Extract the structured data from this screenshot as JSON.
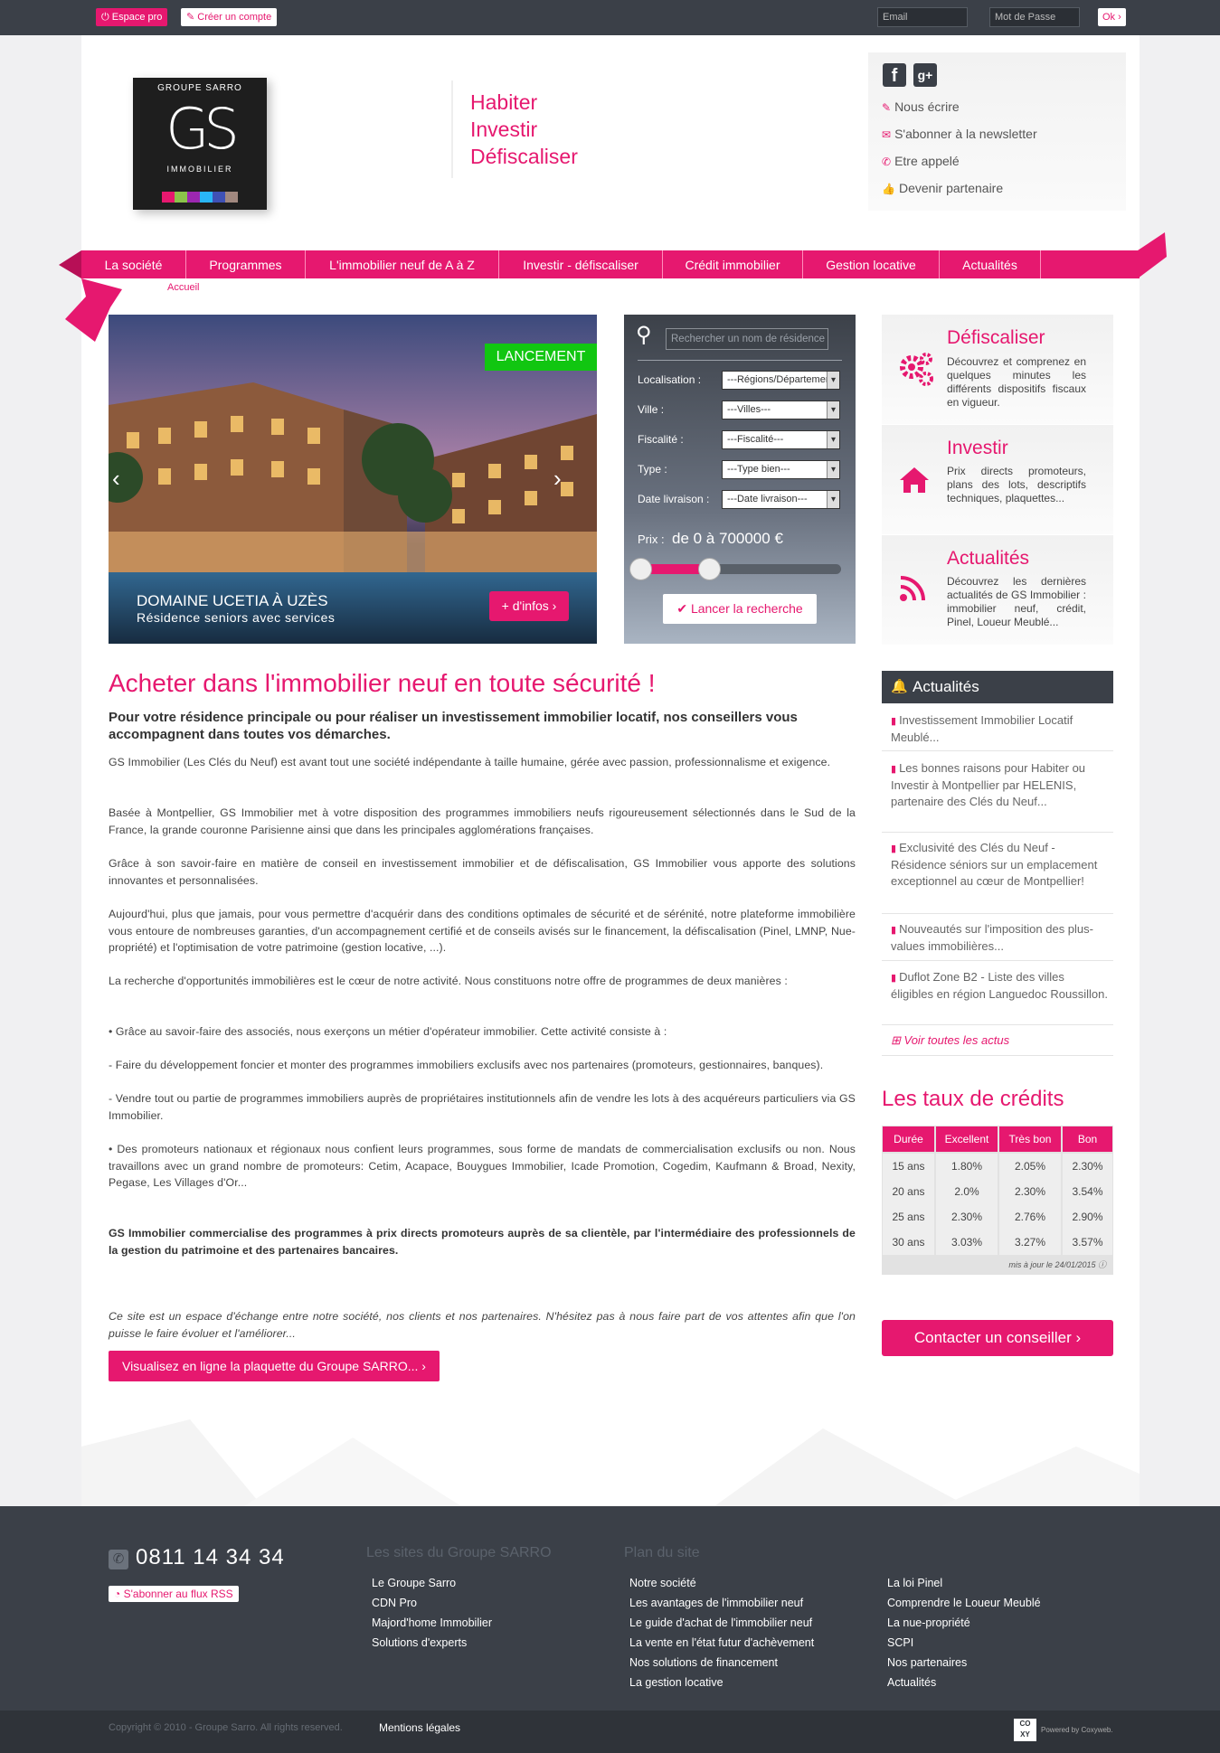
{
  "topbar": {
    "espace_pro": "Espace pro",
    "creer_compte": "Créer un compte",
    "email_placeholder": "Email",
    "password_placeholder": "Mot de Passe",
    "ok": "Ok ›"
  },
  "header": {
    "logo_top": "GROUPE SARRO",
    "logo_mark": "GS",
    "logo_sub": "IMMOBILIER",
    "tagline": [
      "Habiter",
      "Investir",
      "Défiscaliser"
    ],
    "links": [
      "Nous écrire",
      "S'abonner à la newsletter",
      "Etre appelé",
      "Devenir partenaire"
    ]
  },
  "nav": [
    "La société",
    "Programmes",
    "L'immobilier neuf de A à Z",
    "Investir - défiscaliser",
    "Crédit immobilier",
    "Gestion locative",
    "Actualités"
  ],
  "breadcrumb": "Accueil",
  "hero": {
    "badge": "LANCEMENT",
    "title": "DOMAINE UCETIA À UZÈS",
    "subtitle": "Résidence seniors avec services",
    "cta": "+ d'infos ›",
    "prev": "‹",
    "next": "›"
  },
  "search": {
    "placeholder": "Rechercher un nom de résidence",
    "fields": [
      {
        "label": "Localisation :",
        "value": "---Régions/Départements---"
      },
      {
        "label": "Ville :",
        "value": "---Villes---"
      },
      {
        "label": "Fiscalité :",
        "value": "---Fiscalité---"
      },
      {
        "label": "Type :",
        "value": "---Type bien---"
      },
      {
        "label": "Date livraison :",
        "value": "---Date livraison---"
      }
    ],
    "price_label": "Prix :",
    "price_value": "de 0 à 700000 €",
    "price_range": {
      "min": 0,
      "max": 700000,
      "slider_max_fraction": 0.35
    },
    "submit": "Lancer la recherche"
  },
  "side_boxes": [
    {
      "title": "Défiscaliser",
      "text": "Découvrez et comprenez en quelques minutes les différents dispositifs fiscaux en vigueur.",
      "icon": "gears-icon"
    },
    {
      "title": "Investir",
      "text": "Prix directs promoteurs, plans des lots, descriptifs techniques, plaquettes...",
      "icon": "home-icon"
    },
    {
      "title": "Actualités",
      "text": "Découvrez les dernières actualités de GS Immobilier : immobilier neuf, crédit, Pinel, Loueur Meublé...",
      "icon": "rss-icon"
    }
  ],
  "main": {
    "title": "Acheter dans l'immobilier neuf en toute sécurité !",
    "lead": "Pour votre résidence principale ou pour réaliser un investissement immobilier locatif, nos conseillers vous accompagnent dans toutes vos démarches.",
    "paragraphs": [
      "GS Immobilier (Les Clés du Neuf) est avant tout une société indépendante à taille humaine, gérée avec passion, professionnalisme et exigence.",
      "Basée à Montpellier, GS Immobilier met à votre disposition des programmes immobiliers neufs rigoureusement sélectionnés dans le Sud de la France, la grande couronne Parisienne ainsi que dans les principales agglomérations françaises.",
      "Grâce à son savoir-faire en matière de conseil en investissement immobilier et de défiscalisation, GS Immobilier vous apporte des solutions innovantes et personnalisées.",
      "Aujourd'hui, plus que jamais, pour vous permettre d'acquérir dans des conditions optimales de sécurité et de sérénité, notre plateforme immobilière vous entoure de nombreuses garanties, d'un accompagnement certifié et de conseils avisés sur le financement, la défiscalisation (Pinel, LMNP, Nue-propriété) et l'optimisation de votre patrimoine (gestion locative, ...).",
      "La recherche d'opportunités immobilières est le cœur de notre activité. Nous constituons notre offre de programmes de deux manières :",
      "• Grâce au savoir-faire des associés, nous exerçons un métier d'opérateur immobilier. Cette activité consiste à :",
      "- Faire du développement foncier et monter des programmes immobiliers exclusifs avec nos partenaires (promoteurs, gestionnaires, banques).",
      "- Vendre tout ou partie de programmes immobiliers auprès de propriétaires institutionnels afin de vendre les lots à des acquéreurs particuliers via GS Immobilier.",
      "• Des promoteurs nationaux et régionaux nous confient leurs programmes, sous forme de mandats de commercialisation exclusifs ou non. Nous travaillons avec un grand nombre de promoteurs: Cetim, Acapace, Bouygues Immobilier, Icade Promotion, Cogedim, Kaufmann & Broad, Nexity, Pegase, Les Villages d'Or..."
    ],
    "bold_text": "GS Immobilier commercialise des programmes à prix directs promoteurs auprès de sa clientèle, par l'intermédiaire des professionnels de la gestion du patrimoine et des partenaires bancaires.",
    "italic_text": "Ce site est un espace d'échange entre notre société, nos clients et nos partenaires. N'hésitez pas à nous faire part de vos attentes afin que l'on puisse le faire évoluer et l'améliorer...",
    "brochure_button": "Visualisez en ligne la plaquette du Groupe SARRO... ›"
  },
  "news": {
    "title": "Actualités",
    "items": [
      "Investissement Immobilier Locatif Meublé...",
      "Les bonnes raisons pour Habiter ou Investir à Montpellier par HELENIS, partenaire des Clés du Neuf...",
      "Exclusivité des Clés du Neuf - Résidence séniors sur un emplacement exceptionnel au cœur de Montpellier!",
      "Nouveautés sur l'imposition des plus-values immobilières...",
      "Duflot Zone B2 - Liste des villes éligibles en région Languedoc Roussillon."
    ],
    "all_link": "Voir toutes les actus"
  },
  "rates": {
    "title": "Les taux de crédits",
    "headers": [
      "Durée",
      "Excellent",
      "Très bon",
      "Bon"
    ],
    "rows": [
      [
        "15 ans",
        "1.80%",
        "2.05%",
        "2.30%"
      ],
      [
        "20 ans",
        "2.0%",
        "2.30%",
        "3.54%"
      ],
      [
        "25 ans",
        "2.30%",
        "2.76%",
        "2.90%"
      ],
      [
        "30 ans",
        "3.03%",
        "3.27%",
        "3.57%"
      ]
    ],
    "updated": "mis à jour le 24/01/2015"
  },
  "contact_button": "Contacter un conseiller ›",
  "footer": {
    "phone": "0811 14 34 34",
    "rss": "S'abonner au flux RSS",
    "col1_title": "Les sites du Groupe SARRO",
    "col1": [
      "Le Groupe Sarro",
      "CDN Pro",
      "Majord'home Immobilier",
      "Solutions d'experts"
    ],
    "col2_title": "Plan du site",
    "col2": [
      "Notre société",
      "Les avantages de l'immobilier neuf",
      "Le guide d'achat de l'immobilier neuf",
      "La vente en l'état futur d'achèvement",
      "Nos solutions de financement",
      "La gestion locative"
    ],
    "col3": [
      "La loi Pinel",
      "Comprendre le Loueur Meublé",
      "La nue-propriété",
      "SCPI",
      "Nos partenaires",
      "Actualités"
    ],
    "copyright": "Copyright © 2010 - Groupe Sarro. All rights reserved.",
    "legal": "Mentions légales",
    "powered": "Powered by Coxyweb."
  },
  "colors": {
    "accent": "#e6186f",
    "dark": "#3b4048",
    "launch_badge": "#11c611"
  }
}
